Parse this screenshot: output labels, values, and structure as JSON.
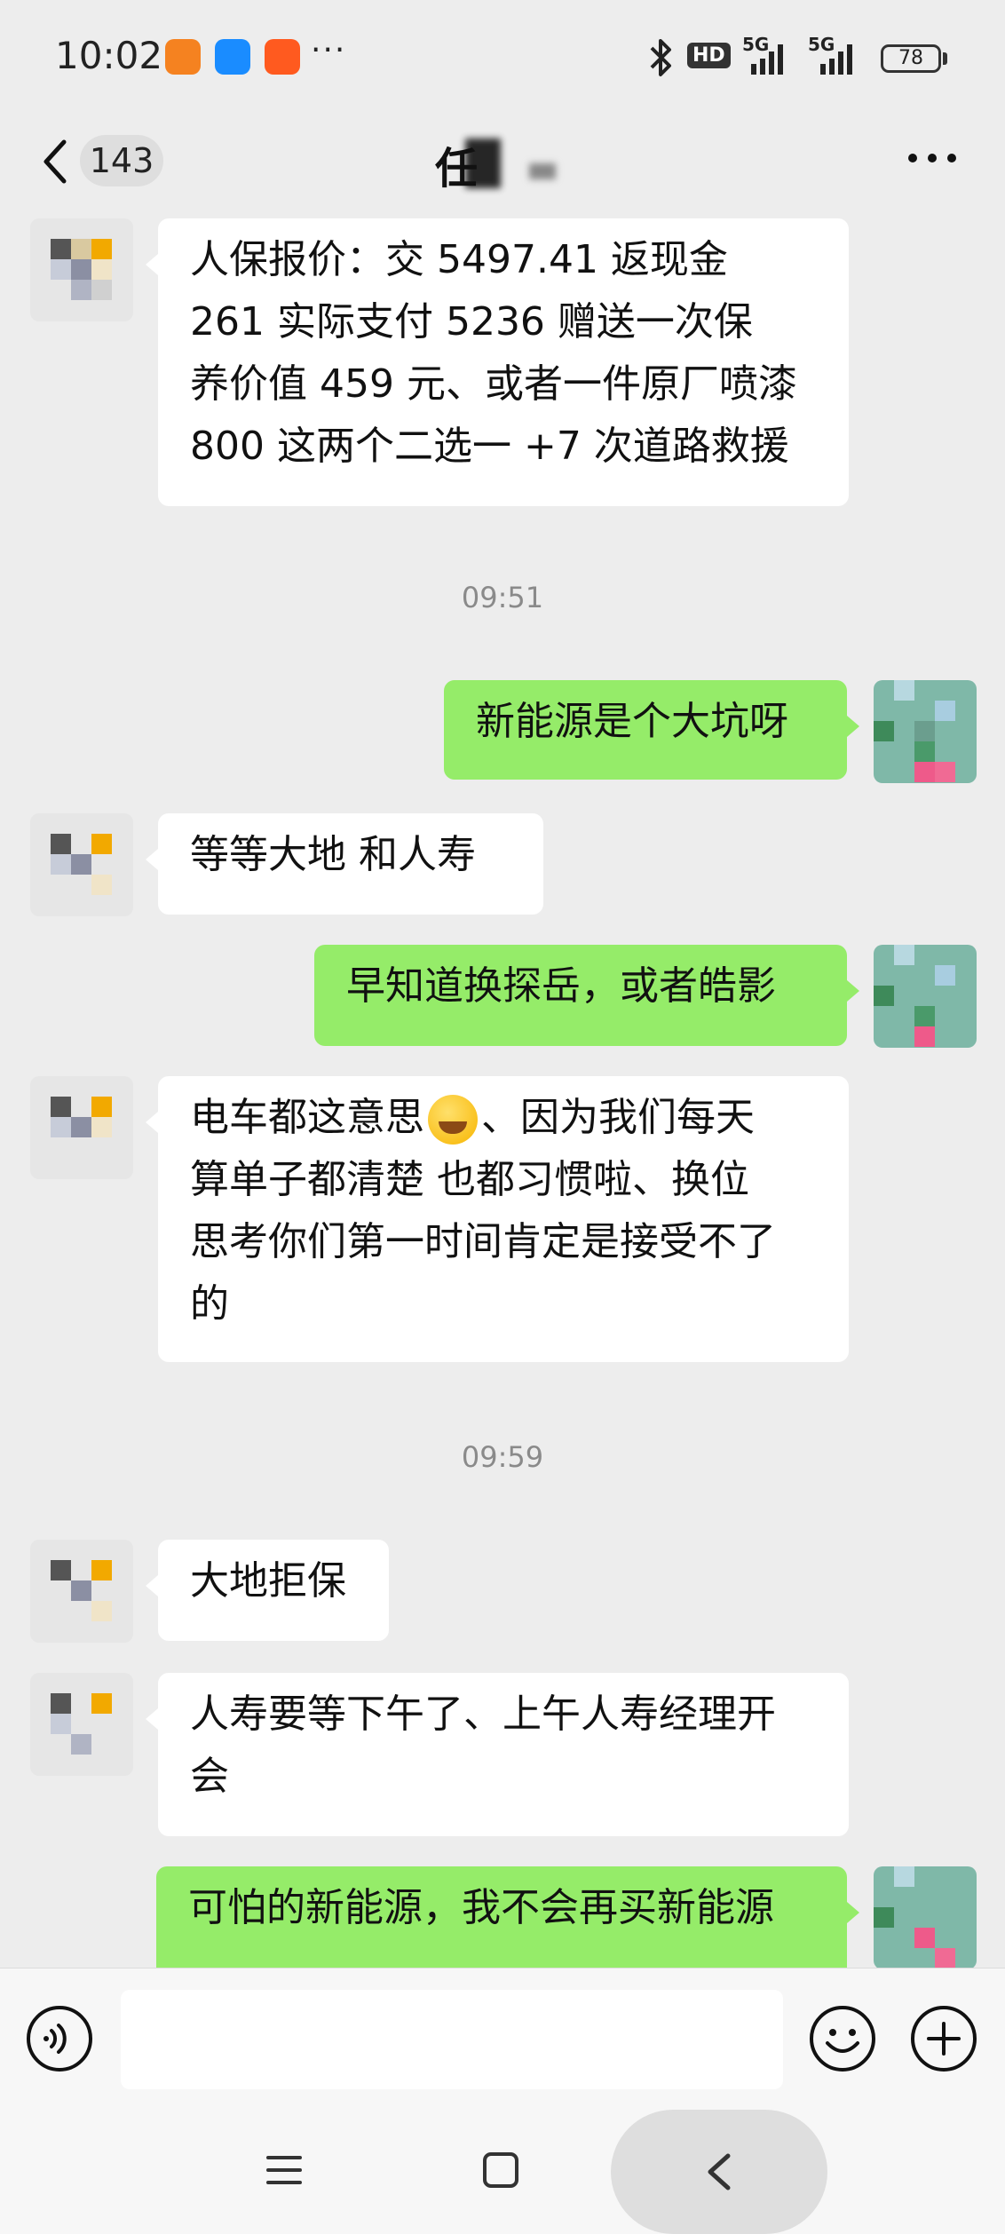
{
  "status_bar": {
    "time": "10:02",
    "more": "···",
    "hd": "HD",
    "signal_1": "5G",
    "signal_2": "5G",
    "battery": "78",
    "app_icons": [
      "didi-icon",
      "hello-icon",
      "kuaishou-icon"
    ]
  },
  "header": {
    "back_icon": "chevron-left-icon",
    "unread_count": "143",
    "title": "任",
    "more_icon": "more-dots-icon"
  },
  "messages": [
    {
      "type": "in",
      "text_lines": [
        "人保报价：交 5497.41  返现金",
        "261   实际支付 5236  赠送一次保",
        "养价值 459 元、或者一件原厂喷漆",
        "800 这两个二选一 +7 次道路救援"
      ]
    },
    {
      "type": "time",
      "text": "09:51"
    },
    {
      "type": "out",
      "text_lines": [
        "新能源是个大坑呀"
      ]
    },
    {
      "type": "in",
      "text_lines": [
        "等等大地  和人寿"
      ]
    },
    {
      "type": "out",
      "text_lines": [
        "早知道换探岳，或者皓影"
      ]
    },
    {
      "type": "in",
      "text_lines": [
        "电车都这意思",
        "、因为我们每天",
        "算单子都清楚 也都习惯啦、换位",
        "思考你们第一时间肯定是接受不了",
        "的"
      ]
    },
    {
      "type": "time",
      "text": "09:59"
    },
    {
      "type": "in",
      "text_lines": [
        "大地拒保"
      ]
    },
    {
      "type": "in",
      "text_lines": [
        "人寿要等下午了、上午人寿经理开",
        "会"
      ]
    },
    {
      "type": "out",
      "text_lines": [
        "可怕的新能源，我不会再买新能源"
      ]
    }
  ],
  "input_bar": {
    "voice_icon": "voice-icon",
    "emoji_icon": "emoji-icon",
    "plus_icon": "plus-icon",
    "placeholder": ""
  },
  "system_nav": {
    "menu_icon": "menu-icon",
    "home_icon": "home-icon",
    "back_icon": "back-icon"
  },
  "colors": {
    "background": "#ededed",
    "bubble_out": "#95ec69",
    "bubble_in": "#ffffff",
    "timestamp": "#8a8a8a"
  }
}
